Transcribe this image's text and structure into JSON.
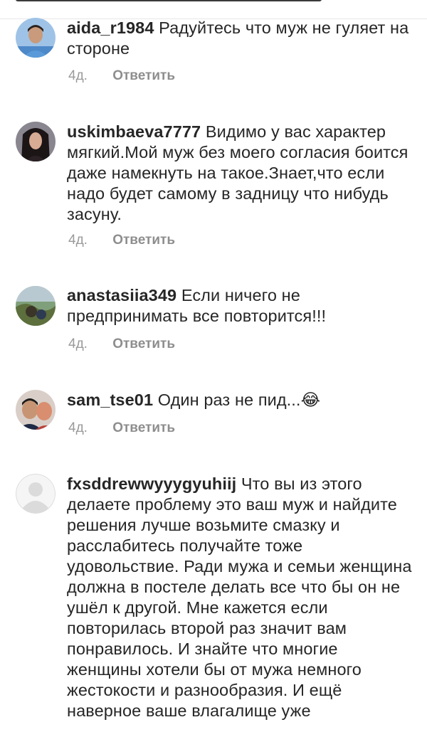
{
  "comments": [
    {
      "username": "aida_r1984",
      "text": "Радуйтесь что муж не гуляет на стороне",
      "time": "4д.",
      "reply_label": "Ответить"
    },
    {
      "username": "uskimbaeva7777",
      "text": "Видимо у вас характер мягкий.Мой муж без моего согласия боится даже намекнуть на такое.Знает,что если надо будет самому в задницу что нибудь засуну.",
      "time": "4д.",
      "reply_label": "Ответить"
    },
    {
      "username": "anastasiia349",
      "text": "Если ничего не предпринимать все повторится!!!",
      "time": "4д.",
      "reply_label": "Ответить"
    },
    {
      "username": "sam_tse01",
      "text": "Один раз не пид...😂",
      "time": "4д.",
      "reply_label": "Ответить"
    },
    {
      "username": "fxsddrewwyyygyuhiij",
      "text": "Что вы из этого делаете проблему это ваш муж и найдите решения лучше возьмите смазку и расслабитесь получайте тоже удовольствие. Ради мужа и семьи женщина должна в постеле делать все что бы он не ушёл к другой. Мне кажется если повторилась второй раз значит вам понравилось. И знайте что многие женщины хотели бы от мужа немного жестокости и разнообразия. И ещё наверное ваше влагалище уже"
    }
  ]
}
